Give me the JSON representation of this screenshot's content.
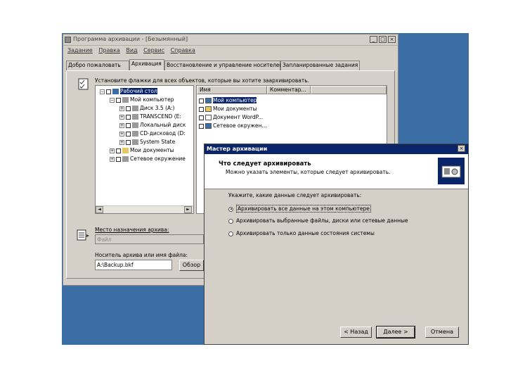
{
  "back_window": {
    "title": "Программа архивации - [Безымянный]",
    "menu": [
      "Задание",
      "Правка",
      "Вид",
      "Сервис",
      "Справка"
    ],
    "tabs": [
      "Добро пожаловать",
      "Архивация",
      "Восстановление и управление носителем",
      "Запланированные задания"
    ],
    "active_tab": 1,
    "instruction": "Установите флажки для всех объектов, которые вы хотите заархивировать.",
    "tree": [
      {
        "label": "Рабочий стол",
        "indent": 0
      },
      {
        "label": "Мой компьютер",
        "indent": 1
      },
      {
        "label": "Диск 3.5 (A:)",
        "indent": 2
      },
      {
        "label": "TRANSCEND (E:",
        "indent": 2
      },
      {
        "label": "Локальный диск",
        "indent": 2
      },
      {
        "label": "CD-дисковод (D:",
        "indent": 2
      },
      {
        "label": "System State",
        "indent": 2
      },
      {
        "label": "Мои документы",
        "indent": 1
      },
      {
        "label": "Сетевое окружение",
        "indent": 1
      }
    ],
    "list_columns": [
      "Имя",
      "Комментар..."
    ],
    "list_items": [
      "Мой компьютер",
      "Мои документы",
      "Документ WordP...",
      "Сетевое окружен..."
    ],
    "destination_label": "Место назначения архива:",
    "destination_value": "Файл",
    "media_label": "Носитель архива или имя файла:",
    "media_value": "A:\\Backup.bkf",
    "browse_button": "Обзор"
  },
  "wizard": {
    "title": "Мастер архивации",
    "close": "×",
    "heading": "Что следует архивировать",
    "subheading": "Можно указать элементы, которые следует архивировать.",
    "question": "Укажите, какие данные следует архивировать:",
    "options": [
      {
        "label": "Архивировать все данные на этом компьютере",
        "selected": true
      },
      {
        "label": "Архивировать выбранные файлы, диски или сетевые данные",
        "selected": false
      },
      {
        "label": "Архивировать только данные состояния системы",
        "selected": false
      }
    ],
    "back_button": "< Назад",
    "next_button": "Далее >",
    "cancel_button": "Отмена"
  }
}
